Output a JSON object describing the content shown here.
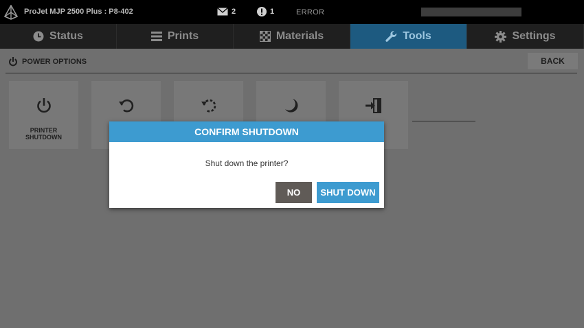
{
  "topbar": {
    "logo_icon": "3d-systems-logo-icon",
    "device_name": "ProJet MJP 2500 Plus : P8-402",
    "messages_icon": "envelope-icon",
    "messages_count": "2",
    "alerts_icon": "exclamation-circle-icon",
    "alerts_count": "1",
    "status": "ERROR"
  },
  "tabs": [
    {
      "label": "Status",
      "icon": "clock-icon",
      "active": false
    },
    {
      "label": "Prints",
      "icon": "list-icon",
      "active": false
    },
    {
      "label": "Materials",
      "icon": "checkered-flag-icon",
      "active": false
    },
    {
      "label": "Tools",
      "icon": "wrench-icon",
      "active": true
    },
    {
      "label": "Settings",
      "icon": "gear-icon",
      "active": false
    }
  ],
  "section": {
    "icon": "power-icon",
    "title": "POWER OPTIONS",
    "back_label": "BACK"
  },
  "tiles": [
    {
      "icon": "power-icon",
      "label_line1": "PRINTER",
      "label_line2": "SHUTDOWN"
    },
    {
      "icon": "restart-icon"
    },
    {
      "icon": "dotted-restart-icon"
    },
    {
      "icon": "moon-icon"
    },
    {
      "icon": "log-out-door-icon"
    }
  ],
  "dialog": {
    "title": "CONFIRM SHUTDOWN",
    "message": "Shut down the printer?",
    "no_label": "NO",
    "confirm_label": "SHUT DOWN"
  },
  "colors": {
    "accent": "#3d9bd0",
    "active_tab": "#1d5a80",
    "no_button": "#605b57",
    "overlay_bg": "#6f6f6f"
  }
}
